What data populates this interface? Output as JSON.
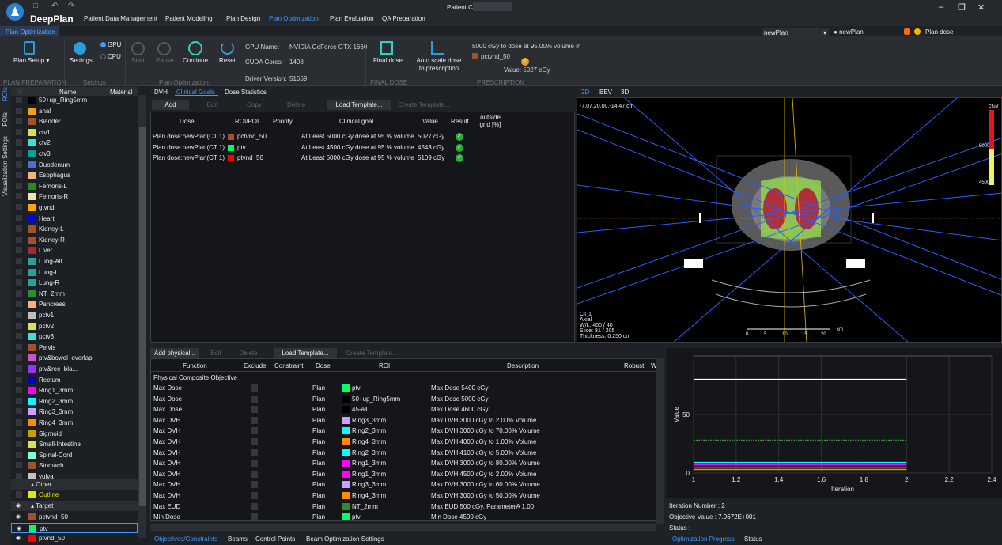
{
  "app": {
    "name": "DeepPlan",
    "title": "Patient              Case : CASE 1"
  },
  "menu": [
    "Patient Data Management",
    "Patient Modeling",
    "Plan Design",
    "Plan Optimization",
    "Plan Evaluation",
    "QA Preparation"
  ],
  "ribbon_tab": "Plan Optimization",
  "ribbon": {
    "plan_setup": "Plan Setup",
    "settings": "Settings",
    "gpu": "GPU",
    "cpu": "CPU",
    "start": "Start",
    "pause": "Pause",
    "continue": "Continue",
    "reset": "Reset",
    "gpu_name_label": "GPU Name:",
    "gpu_name": "NVIDIA GeForce GTX 1660",
    "cuda_label": "CUDA Cores:",
    "cuda": "1408",
    "driver_label": "Driver Version:",
    "driver": "51659",
    "final_dose": "Final dose",
    "auto_scale": "Auto scale dose to prescription",
    "prescription_text": "5000 cGy to dose at 95.00% volume in",
    "prescription_roi": "pctvnd_50",
    "prescription_value": "Value: 5027 cGy",
    "groups": {
      "prep": "PLAN PREPARATION",
      "settings": "Settings",
      "opt": "Plan Optimization",
      "final": "FINAL DOSE",
      "presc": "PRESCRIPTION"
    }
  },
  "top_right": {
    "plan_select": "newPlan",
    "plan_label": "newPlan",
    "dose_label": "Plan dose"
  },
  "left_tabs": [
    "ROIs",
    "POIs",
    "Visualization Settings"
  ],
  "roi_header": {
    "name": "Name",
    "material": "Material"
  },
  "rois": [
    {
      "name": "50+up_Ring5mm",
      "color": "#000000"
    },
    {
      "name": "anal",
      "color": "#e8a317"
    },
    {
      "name": "Bladder",
      "color": "#a0522d"
    },
    {
      "name": "ctv1",
      "color": "#d4e157"
    },
    {
      "name": "ctv2",
      "color": "#40e0d0"
    },
    {
      "name": "ctv3",
      "color": "#00a0a0"
    },
    {
      "name": "Duodenum",
      "color": "#4a6fd0"
    },
    {
      "name": "Esophagus",
      "color": "#f4b183"
    },
    {
      "name": "Femoris-L",
      "color": "#1f8f1f"
    },
    {
      "name": "Femoris-R",
      "color": "#f5deb3"
    },
    {
      "name": "gtvnd",
      "color": "#ffa500"
    },
    {
      "name": "Heart",
      "color": "#0000ff"
    },
    {
      "name": "Kidney-L",
      "color": "#a0522d"
    },
    {
      "name": "Kidney-R",
      "color": "#a0522d"
    },
    {
      "name": "Liver",
      "color": "#a52a2a"
    },
    {
      "name": "Lung-All",
      "color": "#2aa198"
    },
    {
      "name": "Lung-L",
      "color": "#2aa198"
    },
    {
      "name": "Lung-R",
      "color": "#2aa198"
    },
    {
      "name": "NT_2mm",
      "color": "#2e8b2e"
    },
    {
      "name": "Pancreas",
      "color": "#f4b183"
    },
    {
      "name": "pctv1",
      "color": "#c0c0c0"
    },
    {
      "name": "pctv2",
      "color": "#d4e157"
    },
    {
      "name": "pctv3",
      "color": "#40e0d0"
    },
    {
      "name": "Pelvis",
      "color": "#a0522d"
    },
    {
      "name": "ptv&bowel_overlap",
      "color": "#d050d0"
    },
    {
      "name": "ptv&rec+bla...",
      "color": "#9b30ff"
    },
    {
      "name": "Rectum",
      "color": "#0000cd"
    },
    {
      "name": "Ring1_3mm",
      "color": "#ff00ff"
    },
    {
      "name": "Ring2_3mm",
      "color": "#00ffff"
    },
    {
      "name": "Ring3_3mm",
      "color": "#c8a2ff"
    },
    {
      "name": "Ring4_3mm",
      "color": "#ff8c00"
    },
    {
      "name": "Sigmoid",
      "color": "#c8a000"
    },
    {
      "name": "Small-Intestine",
      "color": "#d4e157"
    },
    {
      "name": "Spinal-Cord",
      "color": "#7fffd4"
    },
    {
      "name": "Stomach",
      "color": "#a0522d"
    },
    {
      "name": "vulva",
      "color": "#c0c0c0"
    }
  ],
  "roi_groups": {
    "other": "Other",
    "outline": "Outline",
    "target": "Target"
  },
  "targets": [
    {
      "name": "pctvnd_50",
      "color": "#a0522d"
    },
    {
      "name": "ptv",
      "color": "#00ff66"
    },
    {
      "name": "ptvnd_50",
      "color": "#ff0000"
    }
  ],
  "tabs": [
    "DVH",
    "Clinical Goals",
    "Dose Statistics"
  ],
  "goal_buttons": [
    "Add",
    "Edit",
    "Copy",
    "Delete",
    "Load Template...",
    "Create Template..."
  ],
  "goal_headers": [
    "Dose",
    "ROI/POI",
    "Priority",
    "Clinical goal",
    "Value",
    "Result",
    "outside grid [%]"
  ],
  "goals": [
    {
      "dose": "Plan dose:newPlan(CT 1)",
      "roi": "pctvnd_50",
      "color": "#a0522d",
      "goal": "At Least 5000 cGy dose at 95 % volume",
      "value": "5027 cGy"
    },
    {
      "dose": "Plan dose:newPlan(CT 1)",
      "roi": "ptv",
      "color": "#00ff66",
      "goal": "At Least 4500 cGy dose at 95 % volume",
      "value": "4543 cGy"
    },
    {
      "dose": "Plan dose:newPlan(CT 1)",
      "roi": "ptvnd_50",
      "color": "#ff0000",
      "goal": "At Least 5000 cGy dose at 95 % volume",
      "value": "5109 cGy"
    }
  ],
  "view_tabs": [
    "2D",
    "BEV",
    "3D"
  ],
  "viewer": {
    "coords": "-7.07,20.00,-14.47  cm",
    "unit": "cGy",
    "cb_high": "5000",
    "cb_low": "4500",
    "info": [
      "CT 1",
      "Axial",
      "W/L: 400 / 40",
      "Slice: 81 / 205",
      "Thickness: 0.250 cm"
    ],
    "scale": [
      "0",
      "5",
      "10",
      "15",
      "20",
      "cm"
    ]
  },
  "obj_buttons": [
    "Add physical...",
    "Edit",
    "Delete",
    "Load Template...",
    "Create Template..."
  ],
  "obj_headers": [
    "Function",
    "Exclude",
    "Constraint",
    "Dose",
    "ROI",
    "Description",
    "Robust",
    "W"
  ],
  "obj_group": "Physical Composite Objective",
  "objectives": [
    {
      "fn": "Max Dose",
      "dose": "Plan",
      "roi": "ptv",
      "color": "#00ff66",
      "desc": "Max Dose 5400 cGy"
    },
    {
      "fn": "Max Dose",
      "dose": "Plan",
      "roi": "50+up_Ring5mm",
      "color": "#000000",
      "desc": "Max Dose 5000 cGy"
    },
    {
      "fn": "Max Dose",
      "dose": "Plan",
      "roi": "45-all",
      "color": "#000000",
      "desc": "Max Dose 4600 cGy"
    },
    {
      "fn": "Max DVH",
      "dose": "Plan",
      "roi": "Ring3_3mm",
      "color": "#c8a2ff",
      "desc": "Max DVH 3000 cGy to 2.00% Volume"
    },
    {
      "fn": "Max DVH",
      "dose": "Plan",
      "roi": "Ring2_3mm",
      "color": "#00ffff",
      "desc": "Max DVH 3000 cGy to 70.00% Volume"
    },
    {
      "fn": "Max DVH",
      "dose": "Plan",
      "roi": "Ring4_3mm",
      "color": "#ff8c00",
      "desc": "Max DVH 4000 cGy to 1.00% Volume"
    },
    {
      "fn": "Max DVH",
      "dose": "Plan",
      "roi": "Ring2_3mm",
      "color": "#00ffff",
      "desc": "Max DVH 4100 cGy to 5.00% Volume"
    },
    {
      "fn": "Max DVH",
      "dose": "Plan",
      "roi": "Ring1_3mm",
      "color": "#ff00ff",
      "desc": "Max DVH 3000 cGy to 80.00% Volume"
    },
    {
      "fn": "Max DVH",
      "dose": "Plan",
      "roi": "Ring1_3mm",
      "color": "#ff00ff",
      "desc": "Max DVH 4500 cGy to 2.00% Volume"
    },
    {
      "fn": "Max DVH",
      "dose": "Plan",
      "roi": "Ring3_3mm",
      "color": "#c8a2ff",
      "desc": "Max DVH 3000 cGy to 60.00% Volume"
    },
    {
      "fn": "Max DVH",
      "dose": "Plan",
      "roi": "Ring4_3mm",
      "color": "#ff8c00",
      "desc": "Max DVH 3000 cGy to 50.00% Volume"
    },
    {
      "fn": "Max EUD",
      "dose": "Plan",
      "roi": "NT_2mm",
      "color": "#2e8b2e",
      "desc": "Max EUD 500 cGy, ParameterA 1.00"
    },
    {
      "fn": "Min Dose",
      "dose": "Plan",
      "roi": "ptv",
      "color": "#00ff66",
      "desc": "Min Dose 4500 cGy"
    }
  ],
  "bottom_tabs": [
    "Objectives/Constraints",
    "Beams",
    "Control Points",
    "Beam Optimization Settings"
  ],
  "chart_data": {
    "type": "line",
    "xlabel": "Iteration",
    "ylabel": "Value",
    "xlim": [
      1,
      2.4
    ],
    "ylim": [
      0,
      100
    ],
    "xticks": [
      "1",
      "1.2",
      "1.4",
      "1.6",
      "1.8",
      "2",
      "2.2",
      "2.4"
    ],
    "yticks": [
      "0",
      "50"
    ],
    "series": [
      {
        "color": "#ffffff",
        "x": [
          1,
          2
        ],
        "y": [
          80,
          80
        ]
      },
      {
        "color": "#2e8b2e",
        "x": [
          1,
          2
        ],
        "y": [
          28,
          28
        ]
      },
      {
        "color": "#00ffff",
        "x": [
          1,
          2
        ],
        "y": [
          9,
          9
        ]
      },
      {
        "color": "#ff00ff",
        "x": [
          1,
          2
        ],
        "y": [
          7,
          7
        ]
      },
      {
        "color": "#c8a2ff",
        "x": [
          1,
          2
        ],
        "y": [
          5,
          5
        ]
      },
      {
        "color": "#ff8c00",
        "x": [
          1,
          2
        ],
        "y": [
          3,
          3
        ]
      }
    ]
  },
  "status": {
    "iter_label": "Iteration Number :",
    "iter": "2",
    "obj_label": "Objective Value :",
    "obj": "7.9672E+001",
    "status_label": "Status :"
  },
  "right_bottom_tabs": [
    "Optimization Progress",
    "Status"
  ]
}
